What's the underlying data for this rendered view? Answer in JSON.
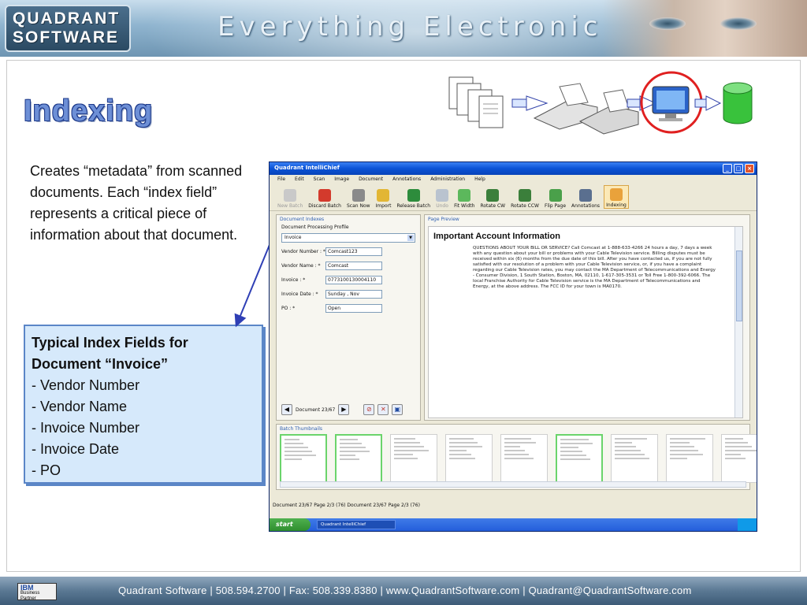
{
  "header": {
    "logo_line1": "QUADRANT",
    "logo_line2": "SOFTWARE",
    "tagline": "Everything Electronic"
  },
  "slide": {
    "title": "Indexing",
    "intro": "Creates “metadata” from scanned documents. Each “index field” represents a critical piece of information about that document.",
    "callout": {
      "title": "Typical Index Fields for Document “Invoice”",
      "items": [
        "- Vendor Number",
        "- Vendor Name",
        "- Invoice Number",
        "- Invoice Date",
        "- PO"
      ]
    }
  },
  "app": {
    "window_title": "Quadrant IntelliChief",
    "menu": [
      "File",
      "Edit",
      "Scan",
      "Image",
      "Document",
      "Annotations",
      "Administration",
      "Help"
    ],
    "toolbar": [
      {
        "label": "New Batch",
        "icon": "new-batch-icon",
        "color": "#c9c9c9",
        "disabled": true
      },
      {
        "label": "Discard Batch",
        "icon": "discard-icon",
        "color": "#d33a2c"
      },
      {
        "label": "Scan Now",
        "icon": "scan-icon",
        "color": "#8a8a8a"
      },
      {
        "label": "Import",
        "icon": "import-icon",
        "color": "#e2b634"
      },
      {
        "label": "Release Batch",
        "icon": "release-icon",
        "color": "#2d8c3c"
      },
      {
        "label": "Undo",
        "icon": "undo-icon",
        "color": "#b9c3cf",
        "disabled": true
      },
      {
        "label": "Fit Width",
        "icon": "fit-width-icon",
        "color": "#5cb85c"
      },
      {
        "label": "Rotate CW",
        "icon": "rotate-cw-icon",
        "color": "#3b7f3b"
      },
      {
        "label": "Rotate CCW",
        "icon": "rotate-ccw-icon",
        "color": "#3b7f3b"
      },
      {
        "label": "Flip Page",
        "icon": "flip-page-icon",
        "color": "#4aa04a"
      },
      {
        "label": "Annotations",
        "icon": "annotations-icon",
        "color": "#5a6f8f"
      },
      {
        "label": "Indexing",
        "icon": "indexing-icon",
        "color": "#e9a23b",
        "active": true
      }
    ],
    "left_pane": {
      "heading": "Document Indexes",
      "profile_label": "Document Processing Profile",
      "profile_value": "Invoice",
      "fields": [
        {
          "label": "Vendor Number : *",
          "value": "Comcast123"
        },
        {
          "label": "Vendor Name : *",
          "value": "Comcast"
        },
        {
          "label": "Invoice : *",
          "value": "0773100130004110"
        },
        {
          "label": "Invoice Date : *",
          "value": "Sunday , Nov"
        },
        {
          "label": "PO : *",
          "value": "Open"
        }
      ],
      "doc_counter": "Document 23/67"
    },
    "preview": {
      "heading": "Page Preview",
      "doc_title": "Important Account Information",
      "doc_body": "QUESTIONS ABOUT YOUR BILL OR SERVICE? Call Comcast at 1-888-633-4266 24 hours a day, 7 days a week with any question about your bill or problems with your Cable Television service. Billing disputes must be received within six (6) months from the due date of this bill. After you have contacted us, if you are not fully satisfied with our resolution of a problem with your Cable Television service, or, if you have a complaint regarding our Cable Television rates, you may contact the MA Department of Telecommunications and Energy - Consumer Division, 1 South Station, Boston, MA, 02110, 1-617-305-3531 or Toll Free 1-800-392-6066. The local Franchise Authority for Cable Television service is the MA Department of Telecommunications and Energy, at the above address. The FCC ID for your town is MA0170."
    },
    "thumbs_heading": "Batch Thumbnails",
    "status_text": "Document 23/67 Page 2/3 (76)     Document 23/67  Page 2/3 (76)",
    "taskbar": {
      "start": "start",
      "task": "Quadrant IntelliChief"
    }
  },
  "footer": {
    "badge_logo": "IBM",
    "badge_line1": "Business",
    "badge_line2": "Partner",
    "text": "Quadrant Software  |  508.594.2700  |  Fax: 508.339.8380  |  www.QuadrantSoftware.com  |  Quadrant@QuadrantSoftware.com"
  },
  "colors": {
    "title_fill": "#6d8fd6",
    "callout_bg": "#d6e9fb",
    "callout_border": "#5b86c7",
    "highlight_ring": "#e02020",
    "arrow": "#2f3fb5"
  }
}
